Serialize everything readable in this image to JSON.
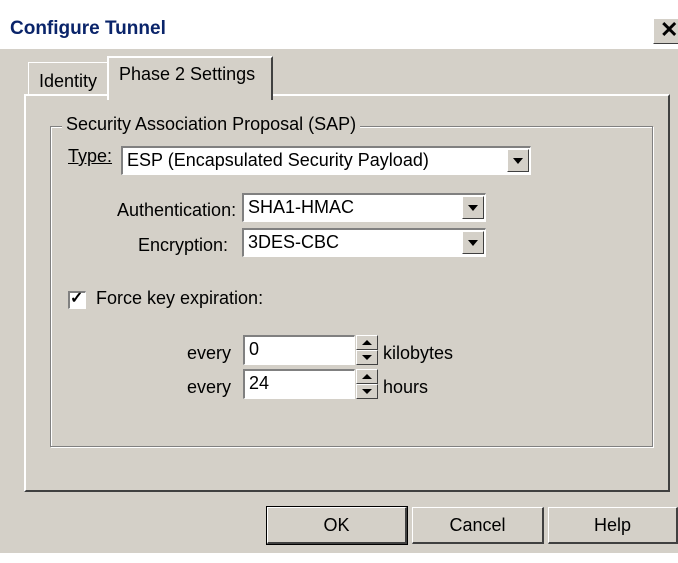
{
  "window": {
    "title": "Configure Tunnel",
    "close_glyph": "✕"
  },
  "tabs": [
    {
      "label": "Identity",
      "active": false
    },
    {
      "label": "Phase 2 Settings",
      "active": true
    }
  ],
  "sap": {
    "legend": "Security Association Proposal (SAP)",
    "type_label": "Type:",
    "type_value": "ESP (Encapsulated Security Payload)",
    "authentication_label": "Authentication:",
    "authentication_value": "SHA1-HMAC",
    "encryption_label": "Encryption:",
    "encryption_value": "3DES-CBC",
    "force_key_label": "Force key expiration:",
    "force_key_checked": true,
    "check_glyph": "✓",
    "every_label": "every",
    "kilobytes_value": "0",
    "kilobytes_unit": "kilobytes",
    "hours_value": "24",
    "hours_unit": "hours"
  },
  "buttons": {
    "ok": "OK",
    "cancel": "Cancel",
    "help": "Help"
  },
  "icons": {
    "close": "close-icon",
    "dropdown": "chevron-down-icon",
    "spin_up": "spin-up-icon",
    "spin_down": "spin-down-icon"
  },
  "colors": {
    "face": "#d4d0c8",
    "title_text": "#0a246a"
  }
}
